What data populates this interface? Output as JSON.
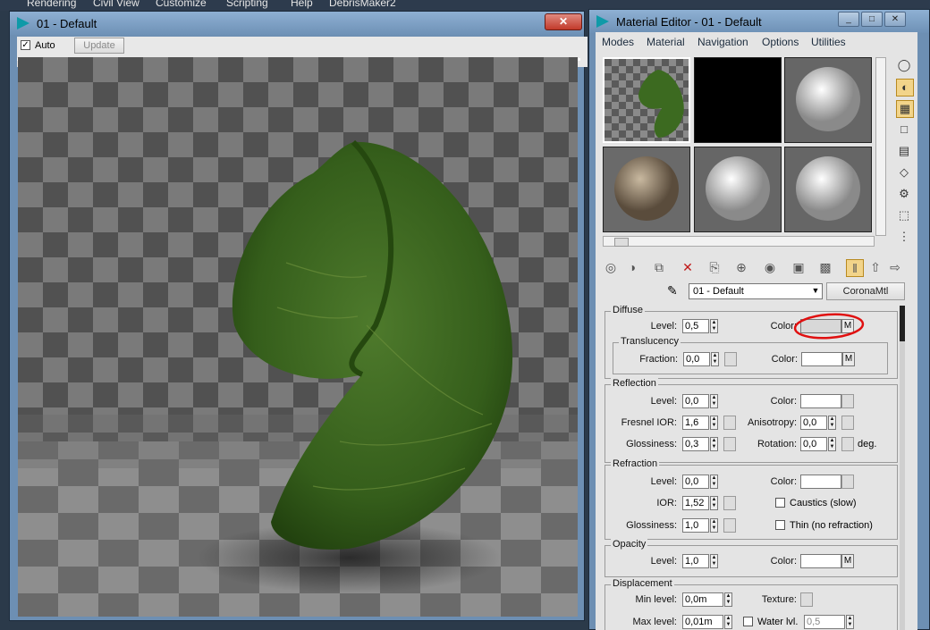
{
  "app_menu": [
    "Rendering",
    "Civil View",
    "Customize",
    "Scripting",
    "Help",
    "DebrisMaker2"
  ],
  "render_window": {
    "title": "01 - Default",
    "auto_label": "Auto",
    "auto_checked": true,
    "update_label": "Update",
    "close_icon": "x-icon"
  },
  "material_editor": {
    "title": "Material Editor - 01 - Default",
    "menus": [
      "Modes",
      "Material",
      "Navigation",
      "Options",
      "Utilities"
    ],
    "material_name": "01 - Default",
    "material_type": "CoronaMtl",
    "diffuse": {
      "title": "Diffuse",
      "level_label": "Level:",
      "level_value": "0,5",
      "color_label": "Color:",
      "map_label": "M",
      "translucency_title": "Translucency",
      "fraction_label": "Fraction:",
      "fraction_value": "0,0",
      "trans_color_label": "Color:"
    },
    "reflection": {
      "title": "Reflection",
      "level_label": "Level:",
      "level_value": "0,0",
      "color_label": "Color:",
      "fresnel_label": "Fresnel IOR:",
      "fresnel_value": "1,6",
      "aniso_label": "Anisotropy:",
      "aniso_value": "0,0",
      "gloss_label": "Glossiness:",
      "gloss_value": "0,3",
      "rotation_label": "Rotation:",
      "rotation_value": "0,0",
      "deg_label": "deg."
    },
    "refraction": {
      "title": "Refraction",
      "level_label": "Level:",
      "level_value": "0,0",
      "color_label": "Color:",
      "ior_label": "IOR:",
      "ior_value": "1,52",
      "caustics_label": "Caustics (slow)",
      "gloss_label": "Glossiness:",
      "gloss_value": "1,0",
      "thin_label": "Thin (no refraction)"
    },
    "opacity": {
      "title": "Opacity",
      "level_label": "Level:",
      "level_value": "1,0",
      "color_label": "Color:",
      "map_label": "M"
    },
    "displacement": {
      "title": "Displacement",
      "min_label": "Min level:",
      "min_value": "0,0m",
      "texture_label": "Texture:",
      "max_label": "Max level:",
      "max_value": "0,01m",
      "water_label": "Water lvl.",
      "water_value": "0,5"
    }
  },
  "colors": {
    "title_bar": "#7fa1c6",
    "leaf_green": "#3f6b22",
    "highlight_circle": "#e01010"
  }
}
